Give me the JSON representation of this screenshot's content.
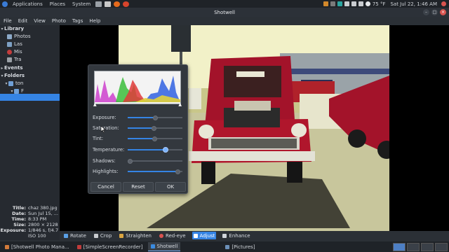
{
  "topbar": {
    "menus": [
      "Applications",
      "Places",
      "System"
    ],
    "tray": {
      "weather": "75 °F",
      "clock": "Sat Jul 22,  1:46 AM"
    }
  },
  "window": {
    "title": "Shotwell"
  },
  "menubar": [
    "File",
    "Edit",
    "View",
    "Photo",
    "Tags",
    "Help"
  ],
  "sidebar": {
    "items": [
      {
        "label": "Library",
        "kind": "header"
      },
      {
        "label": "Photos",
        "kind": "item"
      },
      {
        "label": "Las",
        "kind": "item"
      },
      {
        "label": "Mis",
        "kind": "item"
      },
      {
        "label": "Tra",
        "kind": "item"
      },
      {
        "label": "Events",
        "kind": "header"
      },
      {
        "label": "Folders",
        "kind": "header"
      },
      {
        "label": "ton",
        "kind": "item"
      },
      {
        "label": "F",
        "kind": "item"
      }
    ]
  },
  "properties": [
    {
      "key": "Title:",
      "value": "chaz 380.jpg"
    },
    {
      "key": "Date:",
      "value": "Sun Jul 15, ..."
    },
    {
      "key": "Time:",
      "value": "8:33 PM"
    },
    {
      "key": "Size:",
      "value": "2800 × 2128"
    },
    {
      "key": "Exposure:",
      "value": "1/846 s, f/4.7"
    },
    {
      "key": "",
      "value": "ISO 100"
    }
  ],
  "adjust_dialog": {
    "sliders": [
      {
        "label": "Exposure:",
        "value": 0.5
      },
      {
        "label": "Saturation:",
        "value": 0.5
      },
      {
        "label": "Tint:",
        "value": 0.5
      },
      {
        "label": "Temperature:",
        "value": 0.68,
        "active": true
      },
      {
        "label": "Shadows:",
        "value": 0.0
      },
      {
        "label": "Highlights:",
        "value": 0.9
      }
    ],
    "buttons": {
      "cancel": "Cancel",
      "reset": "Reset",
      "ok": "OK"
    }
  },
  "toolbar": {
    "tools": [
      {
        "label": "Rotate",
        "icon": "rotate-icon",
        "color": "#5aa0e6"
      },
      {
        "label": "Crop",
        "icon": "crop-icon",
        "color": "#c9ccd0"
      },
      {
        "label": "Straighten",
        "icon": "straighten-icon",
        "color": "#d9a441"
      },
      {
        "label": "Red-eye",
        "icon": "red-eye-icon",
        "color": "#d9534f"
      },
      {
        "label": "Adjust",
        "icon": "adjust-icon",
        "color": "#ffffff",
        "selected": true
      },
      {
        "label": "Enhance",
        "icon": "enhance-icon",
        "color": "#d0d4da"
      }
    ]
  },
  "taskbar": {
    "tasks": [
      {
        "label": "[Shotwell Photo Mana...",
        "color": "#d27a3a"
      },
      {
        "label": "[SimpleScreenRecorder]",
        "color": "#c23b3b"
      },
      {
        "label": "Shotwell",
        "color": "#3a8be0",
        "active": true
      },
      {
        "label": "[Pictures]",
        "color": "#6b8fb8"
      }
    ]
  },
  "colors": {
    "accent": "#3584e4",
    "car_body": "#a3132a",
    "sky": "#f2f1c8"
  }
}
